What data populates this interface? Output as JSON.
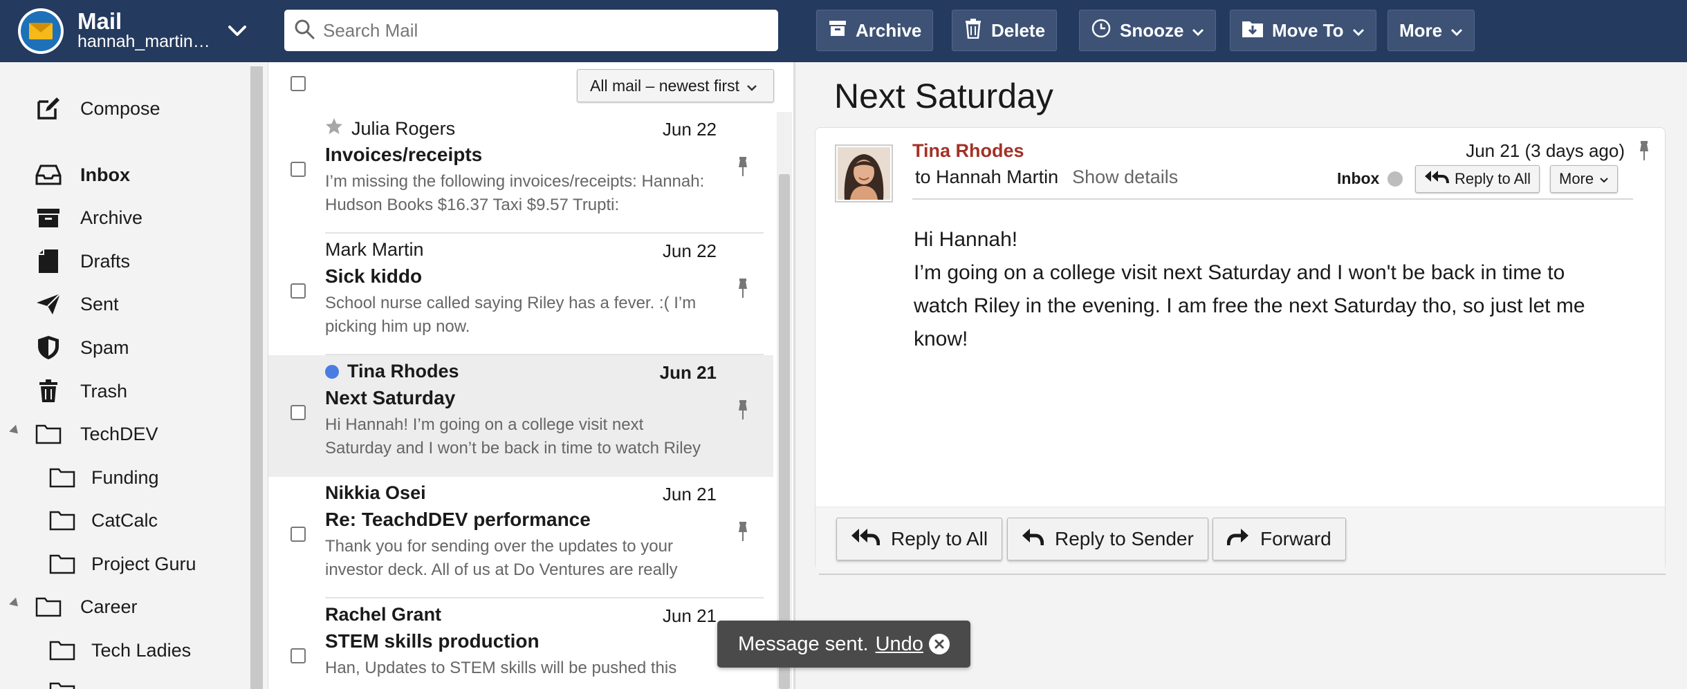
{
  "app": {
    "title": "Mail",
    "account": "hannah_martin…",
    "icons": {
      "logo": "mail-logo-icon",
      "account_menu": "chevron-down-icon"
    }
  },
  "search": {
    "placeholder": "Search Mail",
    "value": "",
    "icon": "search-icon"
  },
  "toolbar": {
    "archive": "Archive",
    "delete": "Delete",
    "snooze": "Snooze",
    "move_to": "Move To",
    "more": "More"
  },
  "sidebar": {
    "compose": "Compose",
    "items": [
      {
        "label": "Inbox",
        "icon": "inbox-icon"
      },
      {
        "label": "Archive",
        "icon": "archive-icon"
      },
      {
        "label": "Drafts",
        "icon": "drafts-icon"
      },
      {
        "label": "Sent",
        "icon": "sent-icon"
      },
      {
        "label": "Spam",
        "icon": "shield-icon"
      },
      {
        "label": "Trash",
        "icon": "trash-icon"
      }
    ],
    "folders": [
      {
        "label": "TechDEV",
        "expanded": true,
        "children": [
          "Funding",
          "CatCalc",
          "Project Guru"
        ]
      },
      {
        "label": "Career",
        "expanded": true,
        "children": [
          "Tech Ladies"
        ]
      }
    ]
  },
  "list": {
    "sort_label": "All mail – newest first",
    "messages": [
      {
        "from": "Julia Rogers",
        "date": "Jun 22",
        "subject": "Invoices/receipts",
        "preview": "I’m missing the following invoices/receipts: Hannah: Hudson Books $16.37 Taxi $9.57 Trupti:",
        "starred": true,
        "unread": false,
        "selected": false
      },
      {
        "from": "Mark Martin",
        "date": "Jun 22",
        "subject": "Sick kiddo",
        "preview": "School nurse called saying Riley has a fever. :( I’m picking him up now.",
        "starred": false,
        "unread": false,
        "selected": false
      },
      {
        "from": "Tina Rhodes",
        "date": "Jun 21",
        "subject": "Next Saturday",
        "preview": "Hi Hannah! I’m going on a college visit next Saturday and I won’t be back in time to watch Riley",
        "starred": false,
        "unread": true,
        "selected": true
      },
      {
        "from": "Nikkia Osei",
        "date": "Jun 21",
        "subject": "Re: TeachdDEV performance",
        "preview": "Thank you for sending over the updates to your investor deck. All of us at Do Ventures are really",
        "starred": false,
        "unread": false,
        "selected": false
      },
      {
        "from": "Rachel Grant",
        "date": "Jun 21",
        "subject": "STEM skills production",
        "preview": "Han, Updates to STEM skills will be pushed this",
        "starred": false,
        "unread": false,
        "selected": false
      }
    ]
  },
  "message": {
    "title": "Next Saturday",
    "sender": "Tina Rhodes",
    "to": "to Hannah Martin",
    "show_details": "Show details",
    "date": "Jun 21 (3 days ago)",
    "folder_label": "Inbox",
    "reply_all_small": "Reply to All",
    "more_small": "More",
    "body": [
      "Hi Hannah!",
      "I’m going on a college visit next Saturday and I won't be back in time to watch Riley in the evening. I am free the next Saturday tho, so just let me know!"
    ],
    "actions": {
      "reply_all": "Reply to All",
      "reply_sender": "Reply to Sender",
      "forward": "Forward"
    }
  },
  "toast": {
    "text": "Message sent.",
    "undo": "Undo"
  },
  "colors": {
    "topbar": "#243a5e",
    "toolbar_button": "#3d5275",
    "sender_name": "#a33127",
    "unread_dot": "#4a7de2",
    "toast": "#4a4a4a"
  }
}
